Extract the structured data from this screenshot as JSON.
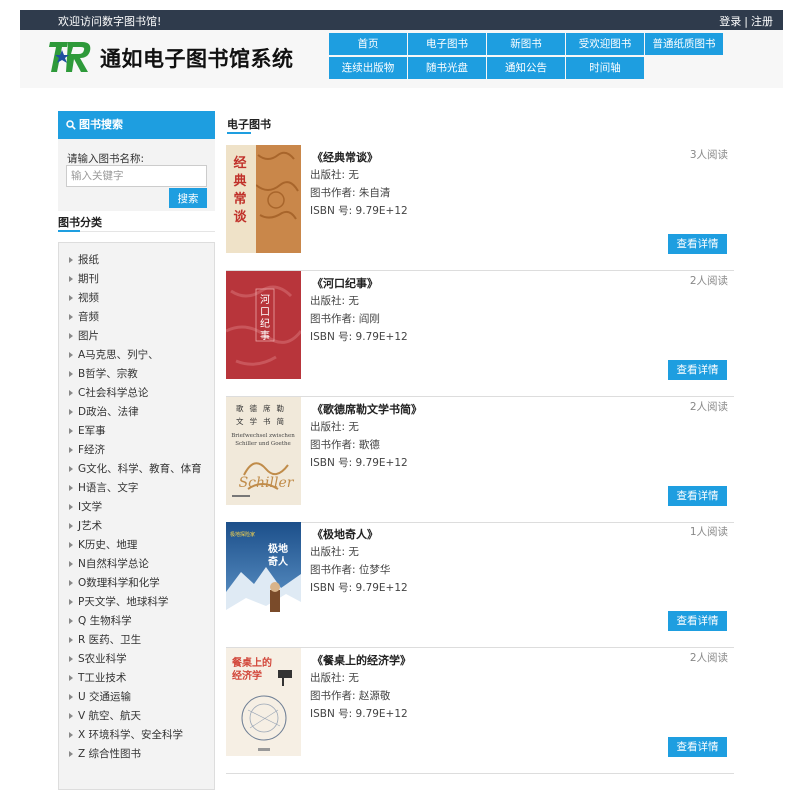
{
  "topbar": {
    "welcome": "欢迎访问数字图书馆!",
    "login": "登录",
    "separator": "|",
    "register": "注册"
  },
  "header": {
    "logo_text": "通如电子图书馆系统",
    "nav": [
      {
        "label": "首页"
      },
      {
        "label": "电子图书"
      },
      {
        "label": "新图书"
      },
      {
        "label": "受欢迎图书"
      },
      {
        "label": "普通纸质图书"
      },
      {
        "label": "连续出版物"
      },
      {
        "label": "随书光盘"
      },
      {
        "label": "通知公告"
      },
      {
        "label": "时间轴"
      }
    ]
  },
  "search": {
    "title": "图书搜索",
    "label": "请输入图书名称:",
    "placeholder": "输入关键字",
    "button": "搜索"
  },
  "categories": {
    "title": "图书分类",
    "items": [
      "报纸",
      "期刊",
      "视频",
      "音频",
      "图片",
      "A马克思、列宁、",
      "B哲学、宗教",
      "C社会科学总论",
      "D政治、法律",
      "E军事",
      "F经济",
      "G文化、科学、教育、体育",
      "H语言、文字",
      "I文学",
      "J艺术",
      "K历史、地理",
      "N自然科学总论",
      "O数理科学和化学",
      "P天文学、地球科学",
      "Q 生物科学",
      "R 医药、卫生",
      "S农业科学",
      "T工业技术",
      "U 交通运输",
      "V 航空、航天",
      "X 环境科学、安全科学",
      "Z 综合性图书"
    ]
  },
  "main": {
    "title": "电子图书",
    "publisher_label": "出版社:",
    "author_label": "图书作者:",
    "isbn_label": "ISBN 号:",
    "detail_button": "查看详情",
    "books": [
      {
        "title": "《经典常谈》",
        "publisher": "无",
        "author": "朱自清",
        "isbn": "9.79E+12",
        "readers": "3人阅读",
        "cover_text": "经典常谈"
      },
      {
        "title": "《河口纪事》",
        "publisher": "无",
        "author": "阎刚",
        "isbn": "9.79E+12",
        "readers": "2人阅读",
        "cover_text": "河口纪事"
      },
      {
        "title": "《歌德席勒文学书简》",
        "publisher": "无",
        "author": "歌德",
        "isbn": "9.79E+12",
        "readers": "2人阅读",
        "cover_text": "歌德席勒文学书简"
      },
      {
        "title": "《极地奇人》",
        "publisher": "无",
        "author": "位梦华",
        "isbn": "9.79E+12",
        "readers": "1人阅读",
        "cover_text": "极地奇人"
      },
      {
        "title": "《餐桌上的经济学》",
        "publisher": "无",
        "author": "赵源敬",
        "isbn": "9.79E+12",
        "readers": "2人阅读",
        "cover_text": "餐桌上的经济学"
      }
    ]
  },
  "colors": {
    "accent": "#1e9ee0",
    "topbar_bg": "#2f3b4c",
    "logo_green": "#2e9a3a",
    "logo_star": "#1e4fa0"
  }
}
